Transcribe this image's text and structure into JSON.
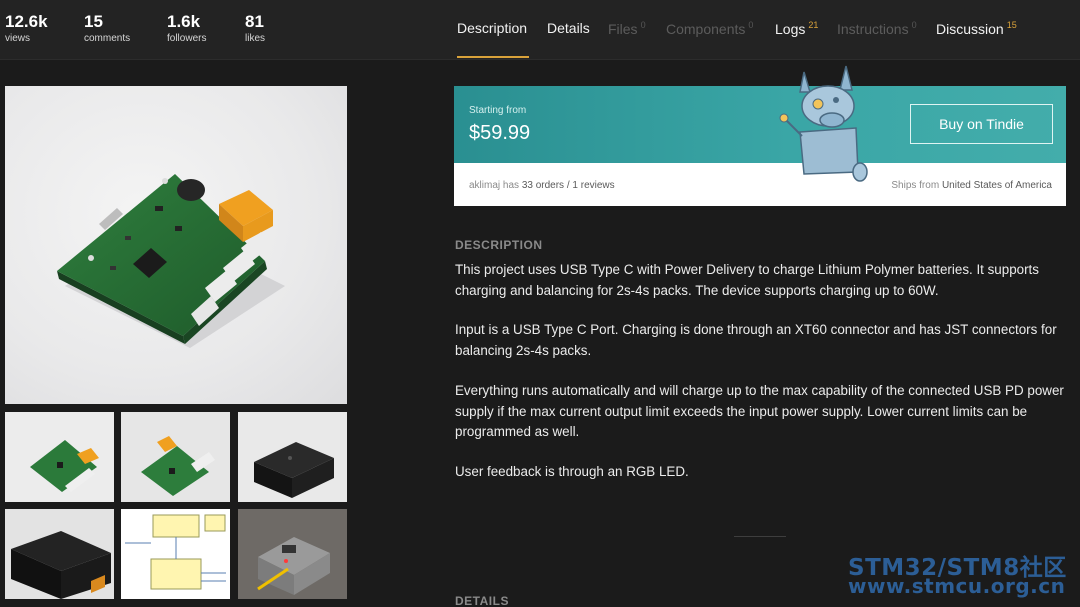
{
  "stats": [
    {
      "value": "12.6k",
      "label": "views"
    },
    {
      "value": "15",
      "label": "comments"
    },
    {
      "value": "1.6k",
      "label": "followers"
    },
    {
      "value": "81",
      "label": "likes"
    }
  ],
  "tabs": [
    {
      "label": "Description",
      "count": "",
      "active": true,
      "enabled": true
    },
    {
      "label": "Details",
      "count": "",
      "enabled": true
    },
    {
      "label": "Files",
      "count": "0",
      "enabled": false
    },
    {
      "label": "Components",
      "count": "0",
      "enabled": false
    },
    {
      "label": "Logs",
      "count": "21",
      "enabled": true
    },
    {
      "label": "Instructions",
      "count": "0",
      "enabled": false
    },
    {
      "label": "Discussion",
      "count": "15",
      "enabled": true
    }
  ],
  "buy": {
    "starting_label": "Starting from",
    "price": "$59.99",
    "button_label": "Buy on Tindie",
    "seller_name": "aklimaj",
    "seller_has": "has",
    "orders": "33 orders / 1 reviews",
    "ships_label": "Ships from",
    "ships_country": "United States of America"
  },
  "description": {
    "heading": "DESCRIPTION",
    "paragraphs": [
      "This project uses USB Type C with Power Delivery to charge Lithium Polymer batteries. It supports charging and balancing for 2s-4s packs. The device supports charging up to 60W.",
      "Input is a USB Type C Port. Charging is done through an XT60 connector and has JST connectors for balancing 2s-4s packs.",
      "Everything runs automatically and will charge up to the max capability of the connected USB PD power supply if the max current output limit exceeds the input power supply. Lower current limits can be programmed as well.",
      "User feedback is through an RGB LED."
    ]
  },
  "details": {
    "heading": "DETAILS"
  },
  "watermark": {
    "line1": "STM32/STM8社区",
    "line2": "www.stmcu.org.cn"
  },
  "colors": {
    "accent": "#d9a23a",
    "teal": "#3aa6a6",
    "background": "#1b1b1b"
  }
}
